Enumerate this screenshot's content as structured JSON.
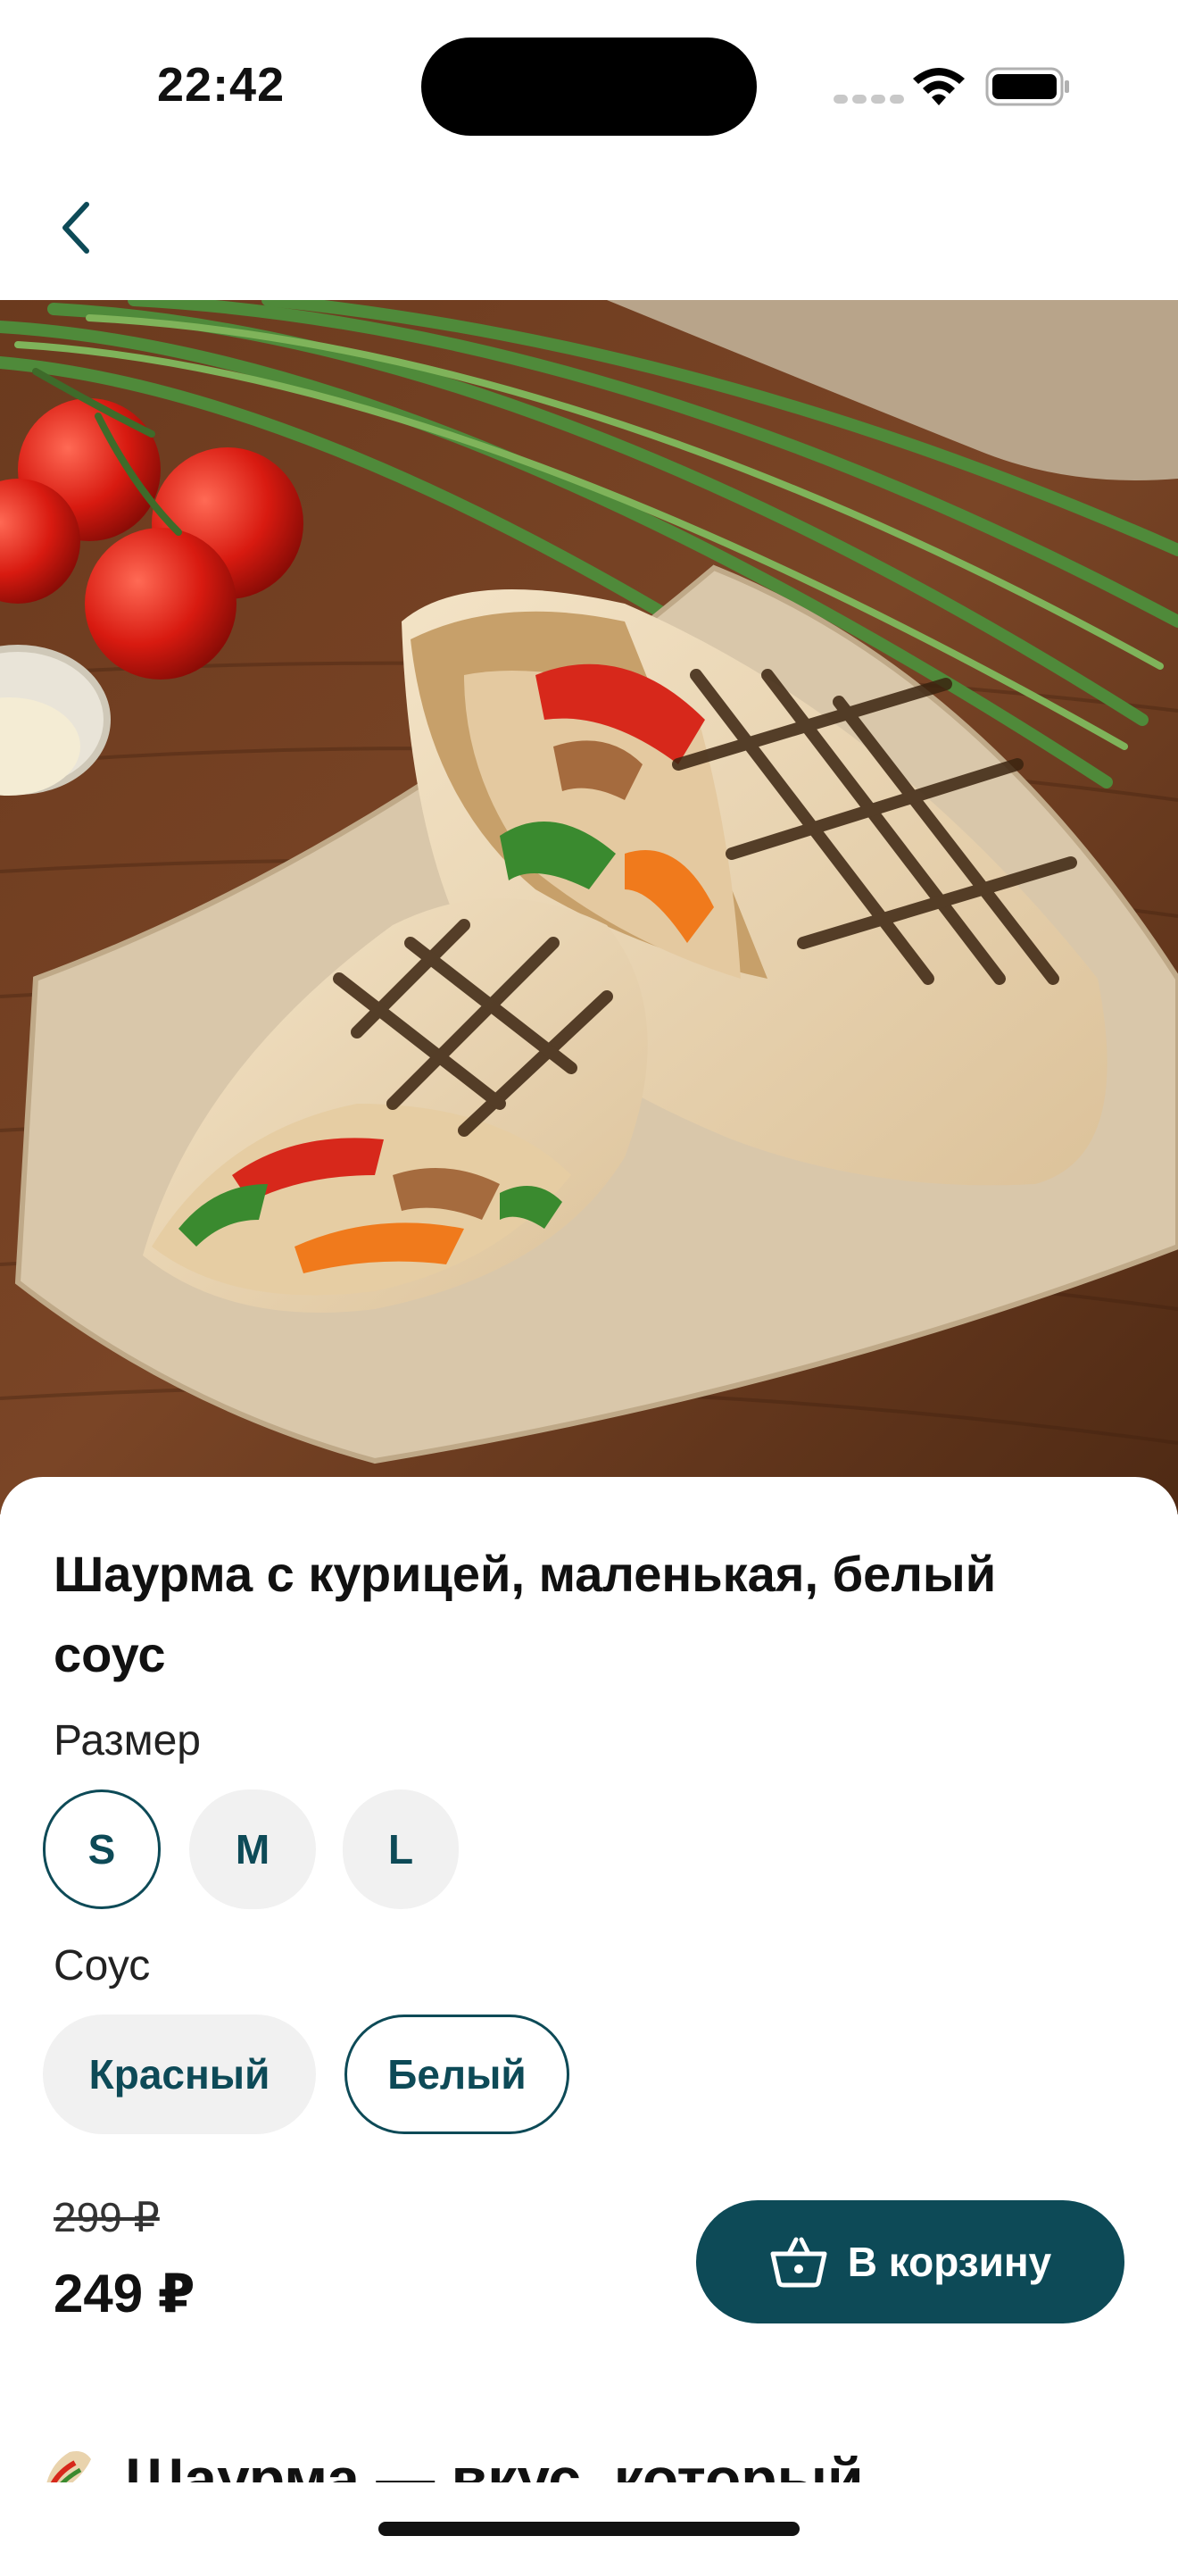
{
  "status_bar": {
    "time": "22:42",
    "icons": [
      "cellular-signal-icon",
      "wifi-icon",
      "battery-icon"
    ]
  },
  "nav": {
    "back_icon": "chevron-left-icon"
  },
  "product": {
    "image": "shawarma-photo",
    "title": "Шаурма с курицей, маленькая, белый соус",
    "size_label": "Размер",
    "sizes": [
      {
        "label": "S",
        "selected": true
      },
      {
        "label": "M",
        "selected": false
      },
      {
        "label": "L",
        "selected": false
      }
    ],
    "sauce_label": "Соус",
    "sauces": [
      {
        "label": "Красный",
        "selected": false
      },
      {
        "label": "Белый",
        "selected": true
      }
    ],
    "old_price": "299 ₽",
    "price": "249 ₽",
    "cart_button_label": "В корзину",
    "cart_icon": "basket-icon",
    "description_heading": "Шаурма — вкус, который"
  },
  "colors": {
    "accent": "#0d4a57",
    "chip_bg": "#f1f1f1",
    "text": "#111111"
  }
}
